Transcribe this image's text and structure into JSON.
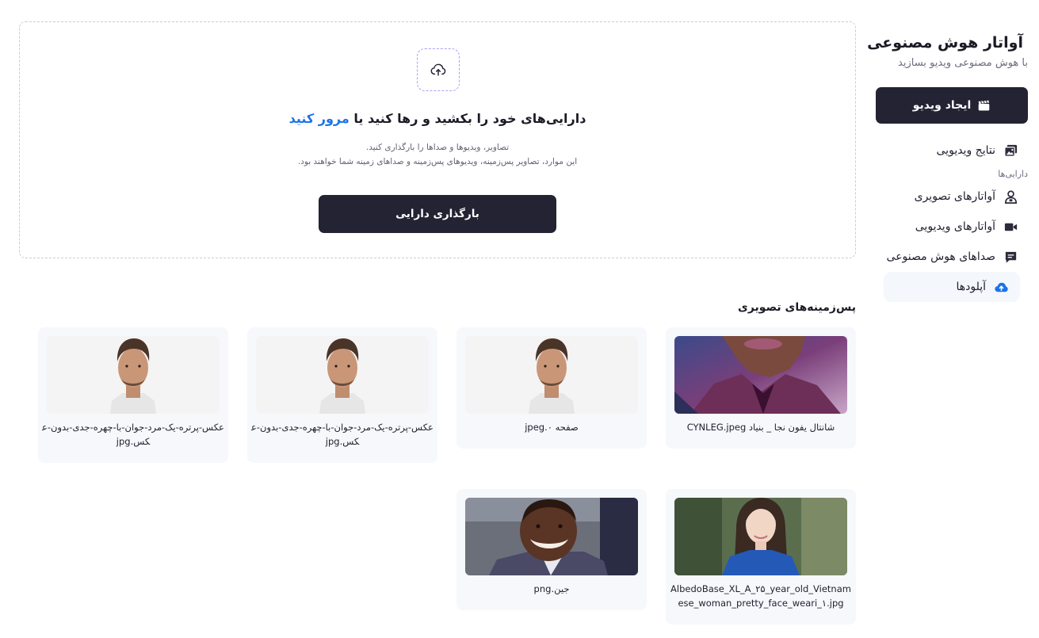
{
  "sidebar": {
    "brand_title": "آواتار هوش مصنوعی",
    "brand_subtitle": "با هوش مصنوعی ویدیو بسازید",
    "create_button": "ایجاد ویدیو",
    "video_results": "نتایج ویدیویی",
    "assets_label": "دارایی‌ها",
    "items": [
      {
        "label": "آواتارهای تصویری",
        "icon": "user-icon"
      },
      {
        "label": "آواتارهای ویدیویی",
        "icon": "video-camera-icon"
      },
      {
        "label": "صداهای هوش مصنوعی",
        "icon": "chat-icon"
      },
      {
        "label": "آپلودها",
        "icon": "cloud-upload-icon",
        "active": true
      }
    ]
  },
  "upload": {
    "title_main": "دارایی‌های خود را بکشید و رها کنید یا",
    "title_link": "مرور کنید",
    "desc_line1": "تصاویر، ویدیوها و صداها را بارگذاری کنید.",
    "desc_line2": "این موارد، تصاویر پس‌زمینه، ویدیوهای پس‌زمینه و صداهای زمینه شما خواهند بود.",
    "button": "بارگذاری دارایی"
  },
  "backgrounds": {
    "heading": "پس‌زمینه‌های تصویری",
    "cards": [
      {
        "caption": "شانتال یفون نجا _ بنیاد CYNLEG.jpeg"
      },
      {
        "caption": "صفحه ۰.jpeg"
      },
      {
        "caption": "عکس-پرتره-یک-مرد-جوان-با-چهره-جدی-بدون-عکس.jpg"
      },
      {
        "caption": "عکس-پرتره-یک-مرد-جوان-با-چهره-جدی-بدون-عکس.jpg"
      },
      {
        "caption": "AlbedoBase_XL_A_۲۵_year_old_Vietnamese_woman_pretty_face_weari_۱.jpg"
      },
      {
        "caption": "جین.png"
      }
    ]
  },
  "colors": {
    "primary_dark": "#242333",
    "accent_blue": "#1a73e8",
    "card_bg": "#f6f8fc"
  }
}
